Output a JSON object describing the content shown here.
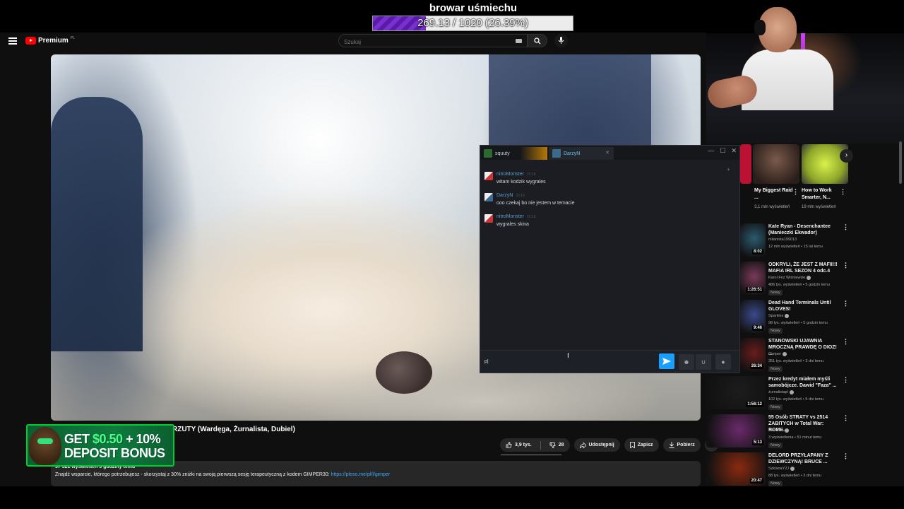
{
  "overlay": {
    "goal_title": "browar uśmiechu",
    "goal_text": "269.13 / 1020 (26.39%)",
    "goal_fraction": 0.2639
  },
  "youtube": {
    "logo_text": "Premium",
    "logo_region": "PL",
    "search_placeholder": "Szukaj",
    "icons": [
      "menu-icon",
      "keyboard-icon",
      "search-icon",
      "mic-icon"
    ]
  },
  "video": {
    "title": "RZUTY (Wardęga, Żurnalista, Dubiel)",
    "likes": "3,9 tys.",
    "dislikes": "28",
    "share_label": "Udostępnij",
    "save_label": "Zapisz",
    "download_label": "Pobierz",
    "more_label": "•••",
    "description": {
      "meta": "57 521 wyświetleń  3 godziny temu",
      "text": "Znajdź wsparcie, którego potrzebujesz - skorzystaj z 30% zniżki na swoją pierwszą sesję terapeutyczną z kodem GIMPER30: ",
      "link": "https://pleso.me/pl/l/gimper"
    }
  },
  "ad": {
    "line1_prefix": "GET ",
    "line1_highlight": "$0.50",
    "line1_suffix": " + 10%",
    "line2": "DEPOSIT BONUS"
  },
  "shorts": [
    {
      "title": "My Biggest Raid ...",
      "views": "3,1 mln wyświetleń"
    },
    {
      "title": "How to Work Smarter, N...",
      "views": "19 mln wyświetleń"
    }
  ],
  "recommendations": [
    {
      "title": "Kate Ryan - Desenchantee (Manieczki Ekwador)",
      "channel": "milanista199013",
      "stats": "12 mln wyświetleń • 15 lat temu",
      "duration": "8:02",
      "badge": "",
      "color": "#2c5a6e"
    },
    {
      "title": "ODKRYLI, ŻE JEST Z MAFII!!! MAFIA IRL SEZON 4 odc.4",
      "channel": "Karol Friz Wiśniewski",
      "stats": "486 tys. wyświetleń • 5 godzin temu",
      "duration": "1:26:51",
      "badge": "Nowy",
      "color": "#7a3a5a"
    },
    {
      "title": "Dead Hand Terminals Until GLOVES!",
      "channel": "Sparkles",
      "stats": "98 tys. wyświetleń • 5 godzin temu",
      "duration": "9:46",
      "badge": "Nowy",
      "color": "#3a4a8a"
    },
    {
      "title": "STANOWSKI UJAWNIA MROCZNĄ PRAWDĘ O DIOZ! ...",
      "channel": "Gimper",
      "stats": "351 tys. wyświetleń • 3 dni temu",
      "duration": "26:34",
      "badge": "Nowy",
      "color": "#6a1c1c"
    },
    {
      "title": "Przez kredyt miałem myśli samobójcze. Dawid \"Faza\" ...",
      "channel": "żurnalistapl",
      "stats": "102 tys. wyświetleń • 5 dni temu",
      "duration": "1:56:12",
      "badge": "Nowy",
      "color": "#1c1c1c"
    },
    {
      "title": "55 Osób STRATY vs 2514 ZABITYCH w Total War: ROME...",
      "channel": "Domena",
      "stats": "3 wyświetlenia • 51 minut temu",
      "duration": "5:13",
      "badge": "Nowy",
      "color": "#6a2a6a"
    },
    {
      "title": "DELORD PRZYŁAPANY Z DZIEWCZYNĄ! BRUCE ...",
      "channel": "SzklanaY2J",
      "stats": "88 tys. wyświetleń • 3 dni temu",
      "duration": "20:47",
      "badge": "Nowy",
      "color": "#8a2a10"
    }
  ],
  "chat": {
    "tabs": [
      {
        "label": "squuty",
        "color": "#2d6a2d"
      },
      {
        "label": "DarzyN",
        "color": "#3b6a8a"
      }
    ],
    "window_controls": [
      "—",
      "☐",
      "✕"
    ],
    "messages": [
      {
        "name": "nitroMonster",
        "time": "22:18",
        "text": "witam kodzik wygrales",
        "avatar_color": "#c33"
      },
      {
        "name": "DarzyN",
        "time": "22:19",
        "text": "ooo czekaj bo nie jestem w temacie",
        "avatar_color": "#3b6a8a"
      },
      {
        "name": "nitroMonster",
        "time": "22:19",
        "text": "wygrales skina",
        "avatar_color": "#c33"
      }
    ],
    "input_value": "p|"
  }
}
